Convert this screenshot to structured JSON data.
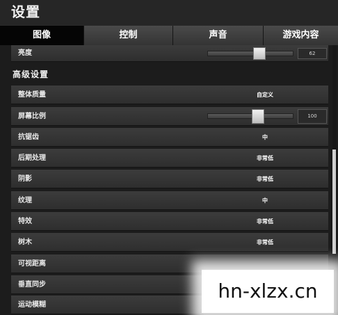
{
  "header": {
    "title": "设置"
  },
  "tabs": [
    {
      "label": "图像",
      "active": true
    },
    {
      "label": "控制",
      "active": false
    },
    {
      "label": "声音",
      "active": false
    },
    {
      "label": "游戏内容",
      "active": false
    }
  ],
  "brightness": {
    "label": "亮度",
    "value": "62",
    "level_percent": 62
  },
  "section": {
    "title": "高级设置"
  },
  "settings": [
    {
      "label": "整体质量",
      "value": "自定义"
    },
    {
      "label": "屏幕比例",
      "value": "100",
      "level_percent": 60
    },
    {
      "label": "抗锯齿",
      "value": "中"
    },
    {
      "label": "后期处理",
      "value": "非常低"
    },
    {
      "label": "阴影",
      "value": "非常低"
    },
    {
      "label": "纹理",
      "value": "中"
    },
    {
      "label": "特效",
      "value": "非常低"
    },
    {
      "label": "树木",
      "value": "非常低"
    },
    {
      "label": "可视距离",
      "value": ""
    },
    {
      "label": "垂直同步",
      "value": ""
    },
    {
      "label": "运动模糊",
      "value": ""
    }
  ],
  "watermark": {
    "text": "hn-xlzx.cn"
  },
  "colors": {
    "active_tab": "#050505",
    "row": "#3c3c3c",
    "thumb": "#e6e6e6"
  }
}
